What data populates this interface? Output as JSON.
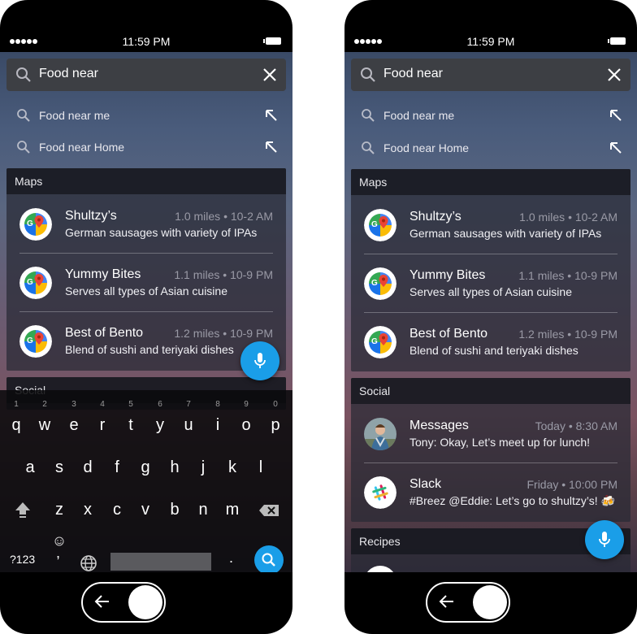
{
  "status": {
    "time": "11:59 PM"
  },
  "search": {
    "query": "Food near"
  },
  "suggestions": [
    "Food near me",
    "Food near Home"
  ],
  "maps": {
    "header": "Maps",
    "items": [
      {
        "title": "Shultzy’s",
        "meta": "1.0 miles • 10-2 AM",
        "subtitle": "German sausages with variety of IPAs"
      },
      {
        "title": "Yummy Bites",
        "meta": "1.1 miles • 10-9 PM",
        "subtitle": "Serves all types of Asian cuisine"
      },
      {
        "title": "Best of Bento",
        "meta": "1.2 miles • 10-9 PM",
        "subtitle": "Blend of sushi and teriyaki dishes"
      }
    ]
  },
  "social": {
    "header": "Social",
    "items": [
      {
        "title": "Messages",
        "meta": "Today • 8:30 AM",
        "subtitle": "Tony: Okay, Let’s meet up for lunch!"
      },
      {
        "title": "Slack",
        "meta": "Friday • 10:00 PM",
        "subtitle": "#Breez @Eddie: Let’s go to shultzy’s! 🍻"
      }
    ]
  },
  "recipes": {
    "header": "Recipes"
  },
  "keyboard": {
    "row1": [
      "q",
      "w",
      "e",
      "r",
      "t",
      "y",
      "u",
      "i",
      "o",
      "p"
    ],
    "row1_nums": [
      "1",
      "2",
      "3",
      "4",
      "5",
      "6",
      "7",
      "8",
      "9",
      "0"
    ],
    "row2": [
      "a",
      "s",
      "d",
      "f",
      "g",
      "h",
      "j",
      "k",
      "l"
    ],
    "row3": [
      "z",
      "x",
      "c",
      "v",
      "b",
      "n",
      "m"
    ],
    "sym": "?123",
    "comma": ",",
    "period": "."
  },
  "colors": {
    "accent": "#1a9ee8"
  },
  "icons": [
    "search-icon",
    "close-icon",
    "arrow-up-left-icon",
    "google-maps-icon",
    "mic-icon",
    "shift-icon",
    "backspace-icon",
    "emoji-icon",
    "globe-icon",
    "back-arrow-icon"
  ]
}
